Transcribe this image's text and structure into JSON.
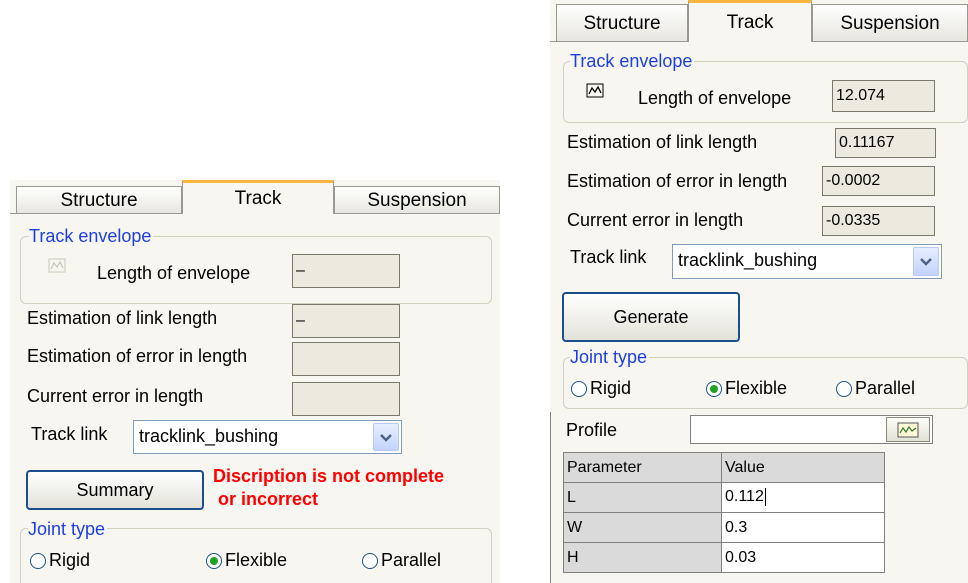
{
  "left_panel": {
    "tabs": [
      {
        "label": "Structure"
      },
      {
        "label": "Track"
      },
      {
        "label": "Suspension"
      }
    ],
    "envelope_group": {
      "title": "Track envelope",
      "length_label": "Length of envelope",
      "length_value": "–"
    },
    "link_length": {
      "label": "Estimation of link length",
      "value": "–"
    },
    "error_estimation": {
      "label": "Estimation of error in length",
      "value": ""
    },
    "current_error": {
      "label": "Current error in length",
      "value": ""
    },
    "track_link": {
      "label": "Track link",
      "value": "tracklink_bushing"
    },
    "summary_button": "Summary",
    "error_message": {
      "line1": "Discription is not complete",
      "line2": "or incorrect",
      "color": "#ff0000"
    },
    "joint_type": {
      "title": "Joint type",
      "options": [
        {
          "label": "Rigid"
        },
        {
          "label": "Flexible"
        },
        {
          "label": "Parallel"
        }
      ],
      "selected": "Flexible"
    }
  },
  "right_panel": {
    "tabs": [
      {
        "label": "Structure"
      },
      {
        "label": "Track"
      },
      {
        "label": "Suspension"
      }
    ],
    "envelope_group": {
      "title": "Track envelope",
      "length_label": "Length of envelope",
      "length_value": "12.074"
    },
    "link_length": {
      "label": "Estimation of link length",
      "value": "0.11167"
    },
    "error_estimation": {
      "label": "Estimation of error in length",
      "value": "-0.0002"
    },
    "current_error": {
      "label": "Current error in length",
      "value": "-0.0335"
    },
    "track_link": {
      "label": "Track link",
      "value": "tracklink_bushing"
    },
    "generate_button": "Generate",
    "joint_type": {
      "title": "Joint type",
      "options": [
        {
          "label": "Rigid"
        },
        {
          "label": "Flexible"
        },
        {
          "label": "Parallel"
        }
      ],
      "selected": "Flexible"
    },
    "profile": {
      "label": "Profile",
      "value": ""
    },
    "parameter_table": {
      "headers": [
        "Parameter",
        "Value"
      ],
      "rows": [
        {
          "name": "L",
          "value": "0.112"
        },
        {
          "name": "W",
          "value": "0.3"
        },
        {
          "name": "H",
          "value": "0.03"
        }
      ]
    }
  },
  "colors": {
    "accent_tab": "#f8b540",
    "legend_text": "#1e3fe0",
    "radio_selected": "#21a121"
  },
  "icons": [
    "envelope-chart-icon",
    "profile-editor-icon",
    "dropdown-arrow-icon"
  ]
}
